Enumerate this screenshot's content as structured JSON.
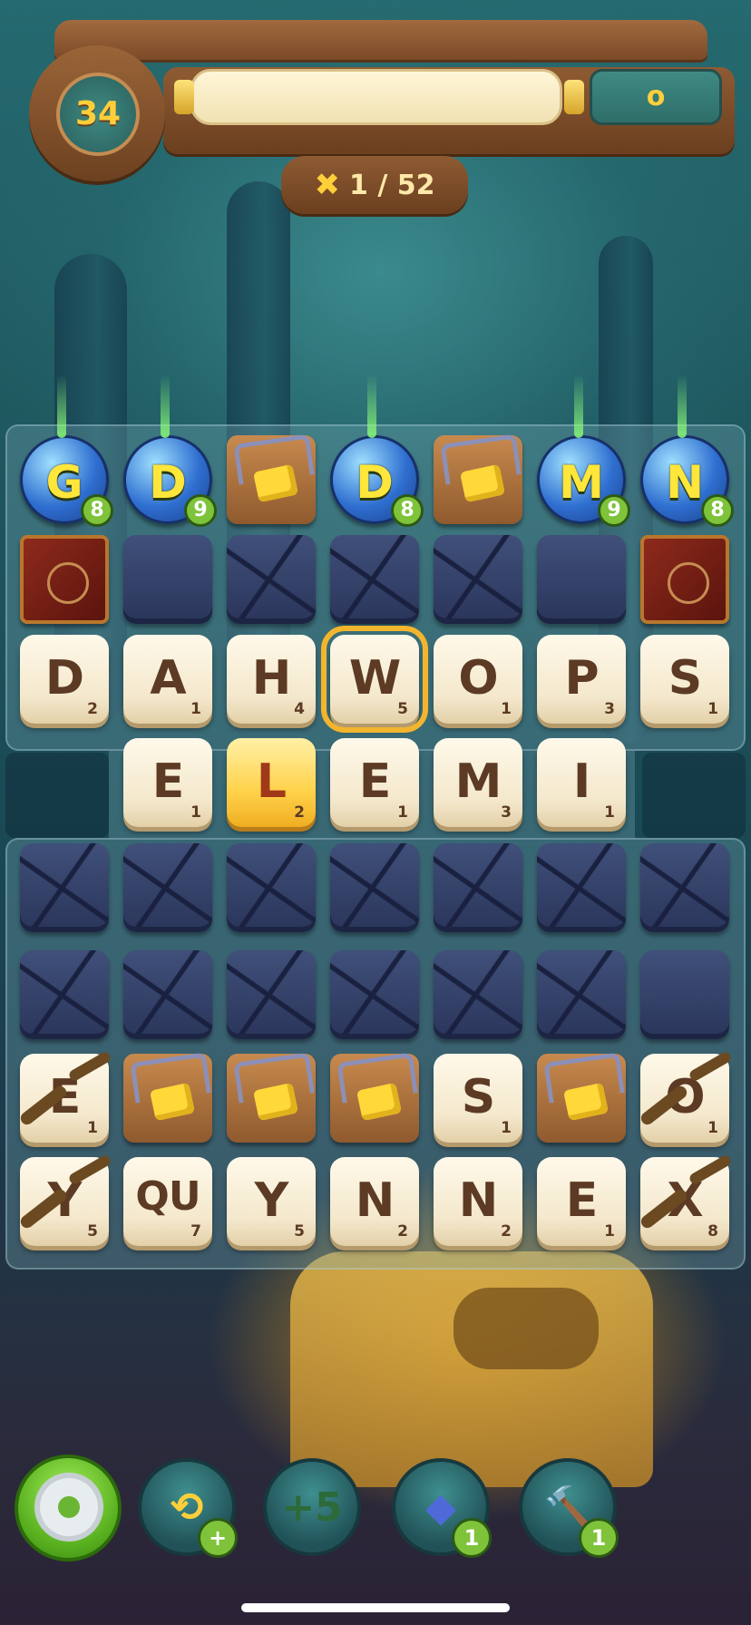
{
  "header": {
    "level": "34",
    "score": "o",
    "moves": "1 / 52",
    "progress_fraction": 0
  },
  "board": {
    "bomb_row": [
      {
        "col": 0,
        "type": "bomb",
        "letter": "G",
        "count": "8"
      },
      {
        "col": 1,
        "type": "bomb",
        "letter": "D",
        "count": "9"
      },
      {
        "col": 2,
        "type": "trap"
      },
      {
        "col": 3,
        "type": "bomb",
        "letter": "D",
        "count": "8"
      },
      {
        "col": 4,
        "type": "trap"
      },
      {
        "col": 5,
        "type": "bomb",
        "letter": "M",
        "count": "9"
      },
      {
        "col": 6,
        "type": "bomb",
        "letter": "N",
        "count": "8"
      }
    ],
    "rows": [
      {
        "cells": [
          {
            "type": "book"
          },
          {
            "type": "stone"
          },
          {
            "type": "stone-cracked"
          },
          {
            "type": "stone-cracked"
          },
          {
            "type": "stone-cracked"
          },
          {
            "type": "stone"
          },
          {
            "type": "book"
          }
        ]
      },
      {
        "cells": [
          {
            "type": "letter",
            "letter": "D",
            "points": "2"
          },
          {
            "type": "letter",
            "letter": "A",
            "points": "1"
          },
          {
            "type": "letter",
            "letter": "H",
            "points": "4"
          },
          {
            "type": "letter",
            "letter": "W",
            "points": "5",
            "selected": true
          },
          {
            "type": "letter",
            "letter": "O",
            "points": "1"
          },
          {
            "type": "letter",
            "letter": "P",
            "points": "3"
          },
          {
            "type": "letter",
            "letter": "S",
            "points": "1"
          }
        ]
      },
      {
        "cells": [
          {
            "type": "empty"
          },
          {
            "type": "letter",
            "letter": "E",
            "points": "1"
          },
          {
            "type": "letter",
            "letter": "L",
            "points": "2",
            "gold": true
          },
          {
            "type": "letter",
            "letter": "E",
            "points": "1"
          },
          {
            "type": "letter",
            "letter": "M",
            "points": "3"
          },
          {
            "type": "letter",
            "letter": "I",
            "points": "1"
          },
          {
            "type": "empty"
          }
        ]
      },
      {
        "cells": [
          {
            "type": "stone-cracked"
          },
          {
            "type": "stone-cracked"
          },
          {
            "type": "stone-cracked"
          },
          {
            "type": "stone-cracked"
          },
          {
            "type": "stone-cracked"
          },
          {
            "type": "stone-cracked"
          },
          {
            "type": "stone-cracked"
          }
        ]
      },
      {
        "cells": [
          {
            "type": "stone-cracked"
          },
          {
            "type": "stone-cracked"
          },
          {
            "type": "stone-cracked"
          },
          {
            "type": "stone-cracked"
          },
          {
            "type": "stone-cracked"
          },
          {
            "type": "stone-cracked"
          },
          {
            "type": "stone"
          }
        ]
      },
      {
        "cells": [
          {
            "type": "letter",
            "letter": "E",
            "points": "1",
            "vine": true
          },
          {
            "type": "trap"
          },
          {
            "type": "trap"
          },
          {
            "type": "trap"
          },
          {
            "type": "letter",
            "letter": "S",
            "points": "1"
          },
          {
            "type": "trap"
          },
          {
            "type": "letter",
            "letter": "O",
            "points": "1",
            "vine": true
          }
        ]
      },
      {
        "cells": [
          {
            "type": "letter",
            "letter": "Y",
            "points": "5",
            "vine": true
          },
          {
            "type": "letter",
            "letter": "QU",
            "points": "7"
          },
          {
            "type": "letter",
            "letter": "Y",
            "points": "5"
          },
          {
            "type": "letter",
            "letter": "N",
            "points": "2"
          },
          {
            "type": "letter",
            "letter": "N",
            "points": "2"
          },
          {
            "type": "letter",
            "letter": "E",
            "points": "1"
          },
          {
            "type": "letter",
            "letter": "X",
            "points": "8",
            "vine": true
          }
        ]
      }
    ]
  },
  "toolbar": {
    "settings_icon": "gear-icon",
    "shuffle": {
      "icon": "shuffle-icon",
      "glyph": "⟲",
      "badge": "+"
    },
    "plus5": {
      "icon": "plus-five-icon",
      "glyph": "+5"
    },
    "magic": {
      "icon": "magic-tile-icon",
      "glyph": "◆",
      "badge": "1"
    },
    "hammer": {
      "icon": "hammer-icon",
      "glyph": "🔨",
      "badge": "1"
    }
  },
  "colors": {
    "accent": "#ffcf3a",
    "wood": "#7b4a27",
    "badge_green": "#7ec33a"
  }
}
